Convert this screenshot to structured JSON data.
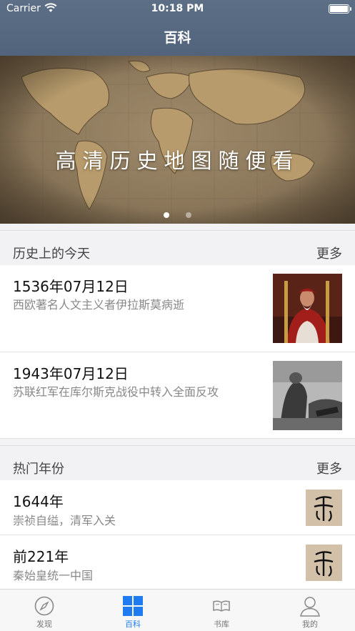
{
  "status_bar": {
    "carrier": "Carrier",
    "time": "10:18 PM"
  },
  "nav": {
    "title": "百科"
  },
  "banner": {
    "caption": "高清历史地图随便看",
    "page_count": 2,
    "active_page": 1
  },
  "today_section": {
    "title": "历史上的今天",
    "more": "更多",
    "items": [
      {
        "date": "1536年07月12日",
        "desc": "西欧著名人文主义者伊拉斯莫病逝",
        "image": "pope-portrait"
      },
      {
        "date": "1943年07月12日",
        "desc": "苏联红军在库尔斯克战役中转入全面反攻",
        "image": "war-photo"
      }
    ]
  },
  "years_section": {
    "title": "热门年份",
    "more": "更多",
    "items": [
      {
        "year": "1644年",
        "desc": "崇祯自缢，清军入关",
        "image": "seal-script-glyph"
      },
      {
        "year": "前221年",
        "desc": "秦始皇统一中国",
        "image": "seal-script-glyph"
      }
    ]
  },
  "tabbar": {
    "items": [
      {
        "label": "发现",
        "icon": "compass-icon",
        "active": false
      },
      {
        "label": "百科",
        "icon": "grid-icon",
        "active": true
      },
      {
        "label": "书库",
        "icon": "book-icon",
        "active": false
      },
      {
        "label": "我的",
        "icon": "person-icon",
        "active": false
      }
    ]
  },
  "colors": {
    "accent": "#1e7cf0",
    "header": "#56687f"
  }
}
